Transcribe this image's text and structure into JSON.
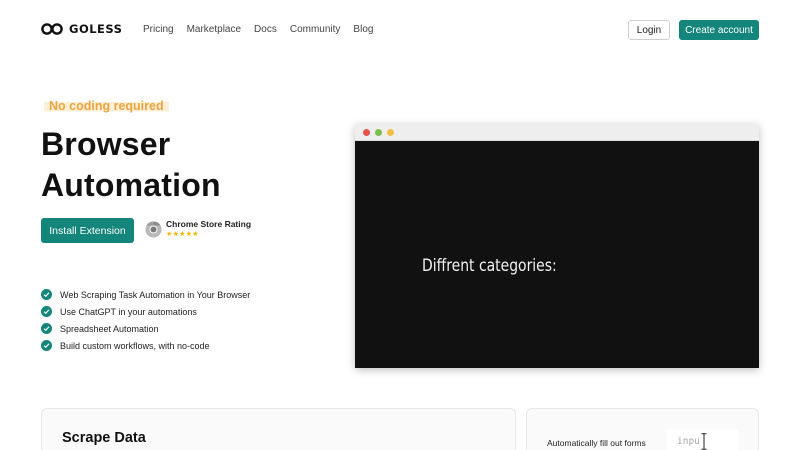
{
  "header": {
    "brand": "GOLESS",
    "nav": [
      "Pricing",
      "Marketplace",
      "Docs",
      "Community",
      "Blog"
    ],
    "login_label": "Login",
    "create_account_label": "Create account"
  },
  "hero": {
    "tag": "No coding required",
    "title_line1": "Browser",
    "title_line2": "Automation",
    "install_label": "Install Extension",
    "rating_label": "Chrome Store Rating",
    "rating_stars": "★★★★★",
    "features": [
      "Web Scraping Task Automation in Your Browser",
      "Use ChatGPT in your automations",
      "Spreadsheet Automation",
      "Build custom workflows, with no-code"
    ]
  },
  "video": {
    "caption": "Diffrent categories:"
  },
  "cards": {
    "scrape_title": "Scrape Data",
    "fill_forms_title": "Automatically fill out forms",
    "demo_input_text": "inpu"
  },
  "colors": {
    "accent": "#13857a",
    "tag_text": "#eaa542",
    "tag_highlight": "#fdf0d6",
    "star": "#f4b400"
  },
  "icons": {
    "logo": "infinity-logo-icon",
    "rating": "chrome-icon",
    "feature": "check-circle-icon",
    "text_cursor": "text-cursor-icon"
  }
}
